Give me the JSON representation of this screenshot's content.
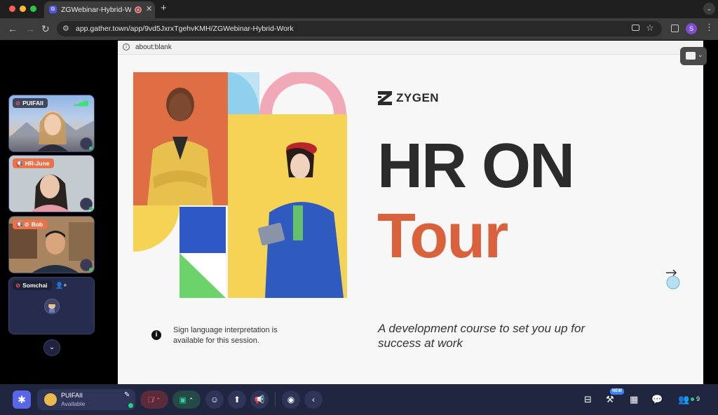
{
  "browser": {
    "tab_title": "ZGWebinar-Hybrid-Work",
    "new_tab": "+",
    "url": "app.gather.town/app/9vd5JxrxTgehvKMH/ZGWebinar-Hybrid-Work",
    "profile_initial": "S"
  },
  "participants": [
    {
      "name": "PUIFAII",
      "badge_style": "muted"
    },
    {
      "name": "HR-June",
      "badge_style": "presenter"
    },
    {
      "name": "Bob",
      "badge_style": "presenter-muted"
    },
    {
      "name": "Somchai",
      "badge_style": "muted"
    }
  ],
  "content": {
    "address": "about:blank"
  },
  "slide": {
    "brand": "ZYGEN",
    "title_line1": "HR ON",
    "title_line2": "Tour",
    "notice": "Sign language interpretation is available for this session.",
    "tagline": "A development course to set you up for success at work",
    "colors": {
      "dark": "#2b2b2b",
      "accent": "#d9613c"
    }
  },
  "dock": {
    "user_name": "PUIFAII",
    "user_status": "Available",
    "people_count": "9",
    "new_label": "NEW"
  }
}
